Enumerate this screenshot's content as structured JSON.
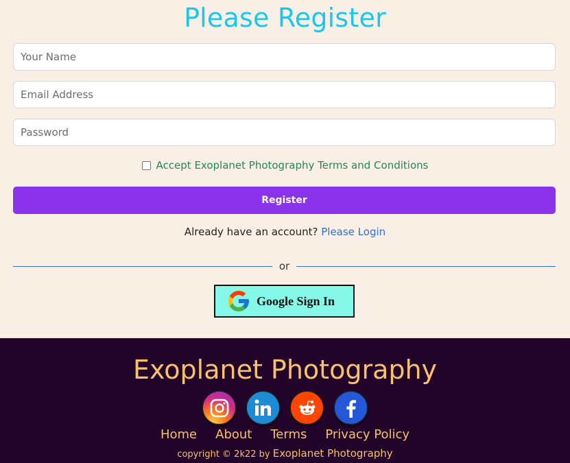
{
  "form": {
    "title": "Please Register",
    "name_placeholder": "Your Name",
    "email_placeholder": "Email Address",
    "password_placeholder": "Password",
    "terms_label": "Accept Exoplanet Photography Terms and Conditions",
    "terms_checked": false,
    "register_label": "Register",
    "have_account_text": "Already have an account?",
    "login_link": "Please Login",
    "divider_text": "or",
    "google_label": "Google Sign In"
  },
  "footer": {
    "title": "Exoplanet Photography",
    "social": [
      {
        "name": "instagram-icon"
      },
      {
        "name": "linkedin-icon"
      },
      {
        "name": "reddit-icon"
      },
      {
        "name": "facebook-icon"
      }
    ],
    "links": [
      "Home",
      "About",
      "Terms",
      "Privacy Policy"
    ],
    "copyright_prefix": "copyright © 2k22 by",
    "copyright_brand": "Exoplanet Photography"
  },
  "colors": {
    "title": "#1cc6ee",
    "accent": "#8a33ea",
    "terms": "#24865a",
    "link": "#2f6fd6",
    "footer_bg": "#23042a",
    "footer_text": "#f6c26b",
    "google_bg": "#86f8e8",
    "page_bg": "#f9efe4"
  }
}
